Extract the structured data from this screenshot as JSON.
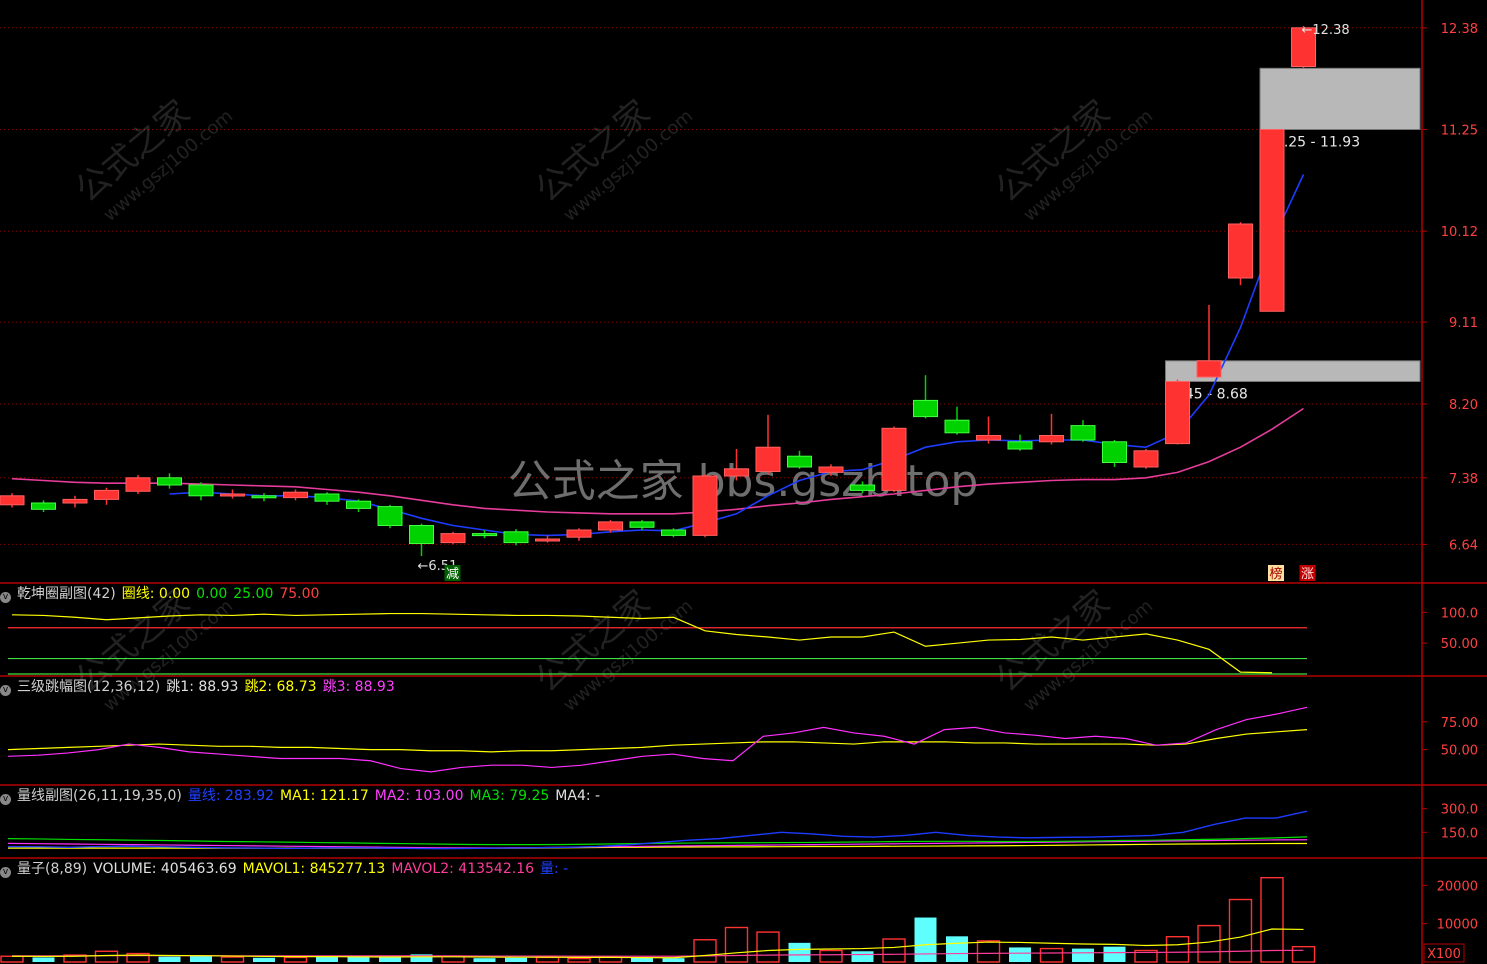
{
  "colors": {
    "up": "#ff3232",
    "down": "#00d200",
    "grid": "#8b0000",
    "axis": "#b40000",
    "text_axis": "#ff4040",
    "ma_blue": "#1e3cff",
    "ma_magenta": "#e63c9a",
    "yellow": "#ffff00",
    "white": "#e0e0e0"
  },
  "watermark": {
    "main": "公式之家 bbs.gszb.top",
    "tile_cn": "公式之家",
    "tile_url": "www.gszj100.com"
  },
  "chart_data": [
    {
      "type": "candlestick",
      "panel": "main",
      "y_ticks": [
        "12.38",
        "11.25",
        "10.12",
        "9.11",
        "8.20",
        "7.38",
        "6.64"
      ],
      "ylim": [
        6.3,
        12.6
      ],
      "candles": [
        {
          "o": 7.08,
          "c": 7.18,
          "h": 7.21,
          "l": 7.05
        },
        {
          "o": 7.1,
          "c": 7.03,
          "h": 7.13,
          "l": 7.0
        },
        {
          "o": 7.1,
          "c": 7.14,
          "h": 7.18,
          "l": 7.05
        },
        {
          "o": 7.14,
          "c": 7.24,
          "h": 7.27,
          "l": 7.08
        },
        {
          "o": 7.23,
          "c": 7.38,
          "h": 7.41,
          "l": 7.2
        },
        {
          "o": 7.38,
          "c": 7.3,
          "h": 7.43,
          "l": 7.26
        },
        {
          "o": 7.3,
          "c": 7.18,
          "h": 7.33,
          "l": 7.13
        },
        {
          "o": 7.18,
          "c": 7.2,
          "h": 7.25,
          "l": 7.15
        },
        {
          "o": 7.18,
          "c": 7.16,
          "h": 7.21,
          "l": 7.12
        },
        {
          "o": 7.16,
          "c": 7.22,
          "h": 7.25,
          "l": 7.13
        },
        {
          "o": 7.2,
          "c": 7.12,
          "h": 7.22,
          "l": 7.08
        },
        {
          "o": 7.12,
          "c": 7.04,
          "h": 7.14,
          "l": 7.0
        },
        {
          "o": 7.06,
          "c": 6.85,
          "h": 7.08,
          "l": 6.82
        },
        {
          "o": 6.85,
          "c": 6.65,
          "h": 6.87,
          "l": 6.51
        },
        {
          "o": 6.66,
          "c": 6.76,
          "h": 6.78,
          "l": 6.64
        },
        {
          "o": 6.76,
          "c": 6.74,
          "h": 6.8,
          "l": 6.71
        },
        {
          "o": 6.78,
          "c": 6.66,
          "h": 6.81,
          "l": 6.63
        },
        {
          "o": 6.7,
          "c": 6.7,
          "h": 6.74,
          "l": 6.66
        },
        {
          "o": 6.72,
          "c": 6.8,
          "h": 6.82,
          "l": 6.68
        },
        {
          "o": 6.8,
          "c": 6.89,
          "h": 6.91,
          "l": 6.77
        },
        {
          "o": 6.89,
          "c": 6.83,
          "h": 6.91,
          "l": 6.8
        },
        {
          "o": 6.8,
          "c": 6.74,
          "h": 6.82,
          "l": 6.72
        },
        {
          "o": 6.74,
          "c": 7.4,
          "h": 7.42,
          "l": 6.72
        },
        {
          "o": 7.4,
          "c": 7.48,
          "h": 7.7,
          "l": 7.35
        },
        {
          "o": 7.45,
          "c": 7.72,
          "h": 8.08,
          "l": 7.42
        },
        {
          "o": 7.62,
          "c": 7.5,
          "h": 7.68,
          "l": 7.48
        },
        {
          "o": 7.44,
          "c": 7.5,
          "h": 7.53,
          "l": 7.4
        },
        {
          "o": 7.3,
          "c": 7.24,
          "h": 7.34,
          "l": 7.21
        },
        {
          "o": 7.24,
          "c": 7.93,
          "h": 7.95,
          "l": 7.22
        },
        {
          "o": 8.24,
          "c": 8.06,
          "h": 8.52,
          "l": 8.04
        },
        {
          "o": 8.02,
          "c": 7.88,
          "h": 8.17,
          "l": 7.86
        },
        {
          "o": 7.8,
          "c": 7.85,
          "h": 8.06,
          "l": 7.76
        },
        {
          "o": 7.78,
          "c": 7.7,
          "h": 7.86,
          "l": 7.68
        },
        {
          "o": 7.78,
          "c": 7.85,
          "h": 8.09,
          "l": 7.75
        },
        {
          "o": 7.96,
          "c": 7.8,
          "h": 8.02,
          "l": 7.78
        },
        {
          "o": 7.78,
          "c": 7.55,
          "h": 7.8,
          "l": 7.5
        },
        {
          "o": 7.5,
          "c": 7.68,
          "h": 7.7,
          "l": 7.48
        },
        {
          "o": 7.76,
          "c": 8.45,
          "h": 8.47,
          "l": 7.75
        },
        {
          "o": 8.5,
          "c": 8.68,
          "h": 9.3,
          "l": 8.5
        },
        {
          "o": 9.6,
          "c": 10.2,
          "h": 10.22,
          "l": 9.52
        },
        {
          "o": 9.23,
          "c": 11.25,
          "h": 11.25,
          "l": 9.23
        },
        {
          "o": 11.95,
          "c": 12.38,
          "h": 12.4,
          "l": 11.93
        }
      ],
      "ma_blue": [
        null,
        null,
        null,
        null,
        null,
        7.2,
        7.22,
        7.2,
        7.18,
        7.18,
        7.16,
        7.12,
        7.03,
        6.93,
        6.85,
        6.8,
        6.75,
        6.74,
        6.75,
        6.78,
        6.8,
        6.79,
        6.88,
        6.98,
        7.18,
        7.35,
        7.45,
        7.47,
        7.58,
        7.72,
        7.78,
        7.8,
        7.79,
        7.8,
        7.8,
        7.75,
        7.72,
        7.88,
        8.3,
        9.05,
        10.0,
        10.75
      ],
      "ma_magenta": [
        7.37,
        7.35,
        7.33,
        7.32,
        7.32,
        7.32,
        7.31,
        7.3,
        7.29,
        7.28,
        7.25,
        7.22,
        7.18,
        7.13,
        7.08,
        7.04,
        7.02,
        7.0,
        6.99,
        6.98,
        6.98,
        6.98,
        7.0,
        7.03,
        7.07,
        7.1,
        7.14,
        7.17,
        7.2,
        7.24,
        7.28,
        7.31,
        7.33,
        7.35,
        7.36,
        7.36,
        7.38,
        7.44,
        7.56,
        7.72,
        7.92,
        8.15
      ],
      "annotations": {
        "low_label": "←6.51",
        "high_label": "←12.38",
        "zone1": {
          "lo": 8.45,
          "hi": 8.68,
          "label": "8.45 - 8.68"
        },
        "zone2": {
          "lo": 11.25,
          "hi": 11.93,
          "label": "11.25 - 11.93"
        },
        "tag_reduce": "减",
        "tag_bang": "榜",
        "tag_zhang": "涨"
      }
    },
    {
      "type": "line",
      "panel": "qiankun",
      "title": "乾坤圈副图",
      "params": "(42)",
      "items": [
        "圈线: 0.00",
        "0.00",
        "25.00",
        "75.00"
      ],
      "y_ticks": [
        "100.0",
        "50.00"
      ],
      "ylim": [
        0,
        120
      ],
      "levels": [
        75,
        25,
        0
      ],
      "values": [
        96,
        95,
        92,
        88,
        91,
        94,
        96,
        95,
        97,
        95,
        96,
        97,
        98,
        98,
        97,
        96,
        95,
        95,
        94,
        92,
        90,
        92,
        70,
        64,
        60,
        55,
        60,
        60,
        68,
        45,
        50,
        55,
        56,
        60,
        55,
        60,
        65,
        55,
        40,
        3,
        2
      ]
    },
    {
      "type": "line",
      "panel": "tiaofu",
      "title": "三级跳幅图",
      "params": "(12,36,12)",
      "items": [
        "跳1: 88.93",
        "跳2: 68.73",
        "跳3: 88.93"
      ],
      "y_ticks": [
        "75.00",
        "50.00"
      ],
      "ylim": [
        20,
        100
      ],
      "yellow": [
        50,
        51,
        52,
        53,
        54,
        55,
        54,
        53,
        53,
        52,
        52,
        51,
        50,
        50,
        49,
        49,
        48,
        49,
        49,
        50,
        51,
        52,
        54,
        55,
        56,
        57,
        57,
        56,
        55,
        57,
        57,
        57,
        56,
        56,
        55,
        55,
        55,
        55,
        54,
        55,
        60,
        64,
        66,
        68
      ],
      "magenta": [
        44,
        45,
        47,
        50,
        55,
        52,
        48,
        46,
        44,
        42,
        42,
        42,
        40,
        33,
        30,
        34,
        36,
        36,
        34,
        36,
        40,
        44,
        46,
        42,
        40,
        62,
        65,
        70,
        65,
        62,
        55,
        68,
        70,
        65,
        63,
        60,
        62,
        60,
        54,
        56,
        68,
        77,
        82,
        88
      ]
    },
    {
      "type": "line",
      "panel": "liangxian",
      "title": "量线副图",
      "params": "(26,11,19,35,0)",
      "items": [
        "量线: 283.92",
        "MA1: 121.17",
        "MA2: 103.00",
        "MA3: 79.25",
        "MA4: -"
      ],
      "y_ticks": [
        "300.0",
        "150.0"
      ],
      "ylim": [
        0,
        380
      ],
      "blue": [
        60,
        58,
        55,
        60,
        62,
        58,
        55,
        52,
        50,
        48,
        50,
        52,
        50,
        48,
        46,
        48,
        50,
        52,
        55,
        60,
        70,
        85,
        100,
        110,
        130,
        150,
        140,
        125,
        120,
        130,
        150,
        130,
        120,
        115,
        118,
        120,
        125,
        130,
        150,
        200,
        240,
        240,
        283.92
      ],
      "green": [
        110,
        108,
        105,
        103,
        100,
        98,
        95,
        92,
        90,
        88,
        85,
        83,
        80,
        78,
        75,
        73,
        72,
        72,
        73,
        75,
        78,
        80,
        82,
        83,
        84,
        85,
        86,
        88,
        90,
        92,
        93,
        93,
        92,
        92,
        93,
        95,
        98,
        100,
        103,
        106,
        110,
        115,
        121.17
      ],
      "magenta": [
        80,
        78,
        76,
        74,
        72,
        70,
        68,
        66,
        64,
        62,
        60,
        58,
        56,
        54,
        52,
        52,
        52,
        53,
        55,
        58,
        60,
        62,
        64,
        66,
        68,
        70,
        72,
        74,
        76,
        78,
        80,
        82,
        84,
        86,
        88,
        90,
        92,
        94,
        96,
        98,
        100,
        102,
        103
      ],
      "yellow": [
        50,
        50,
        50,
        50,
        50,
        50,
        50,
        50,
        50,
        50,
        50,
        50,
        50,
        50,
        50,
        50,
        50,
        50,
        52,
        54,
        55,
        56,
        57,
        58,
        58,
        59,
        60,
        60,
        61,
        62,
        63,
        64,
        65,
        66,
        68,
        70,
        72,
        74,
        76,
        77,
        78,
        79,
        79.25
      ]
    },
    {
      "type": "bar",
      "panel": "volume",
      "title": "量子",
      "params": "(8,89)",
      "items": [
        "VOLUME: 405463.69",
        "MAVOL1: 845277.13",
        "MAVOL2: 413542.16",
        "量: -"
      ],
      "y_ticks": [
        "20000",
        "10000"
      ],
      "unit_label": "X100",
      "ylim": [
        0,
        24000
      ],
      "values": [
        1500,
        1200,
        1800,
        2800,
        2200,
        1400,
        1600,
        1300,
        1100,
        1200,
        1400,
        1300,
        1200,
        2000,
        1500,
        1000,
        1100,
        1200,
        900,
        1300,
        1100,
        1000,
        5800,
        9000,
        7800,
        5000,
        3000,
        2800,
        6000,
        11600,
        6700,
        5500,
        3800,
        3500,
        3500,
        4000,
        3000,
        6600,
        9500,
        16300,
        22000,
        4000
      ],
      "mavol1": [
        1500,
        1450,
        1500,
        1700,
        1800,
        1700,
        1650,
        1550,
        1450,
        1400,
        1400,
        1350,
        1300,
        1350,
        1350,
        1300,
        1250,
        1250,
        1200,
        1200,
        1150,
        1100,
        1700,
        2400,
        3000,
        3300,
        3400,
        3500,
        3800,
        4500,
        4900,
        5200,
        5100,
        4900,
        4700,
        4600,
        4300,
        4500,
        5200,
        6500,
        8600,
        8500
      ],
      "mavol2": [
        1600,
        1600,
        1600,
        1650,
        1650,
        1650,
        1650,
        1600,
        1600,
        1600,
        1600,
        1600,
        1600,
        1600,
        1600,
        1550,
        1550,
        1550,
        1500,
        1500,
        1500,
        1500,
        1600,
        1700,
        1800,
        1850,
        1900,
        1950,
        2000,
        2100,
        2200,
        2250,
        2300,
        2350,
        2400,
        2450,
        2500,
        2550,
        2650,
        2800,
        3000,
        3050
      ]
    }
  ]
}
